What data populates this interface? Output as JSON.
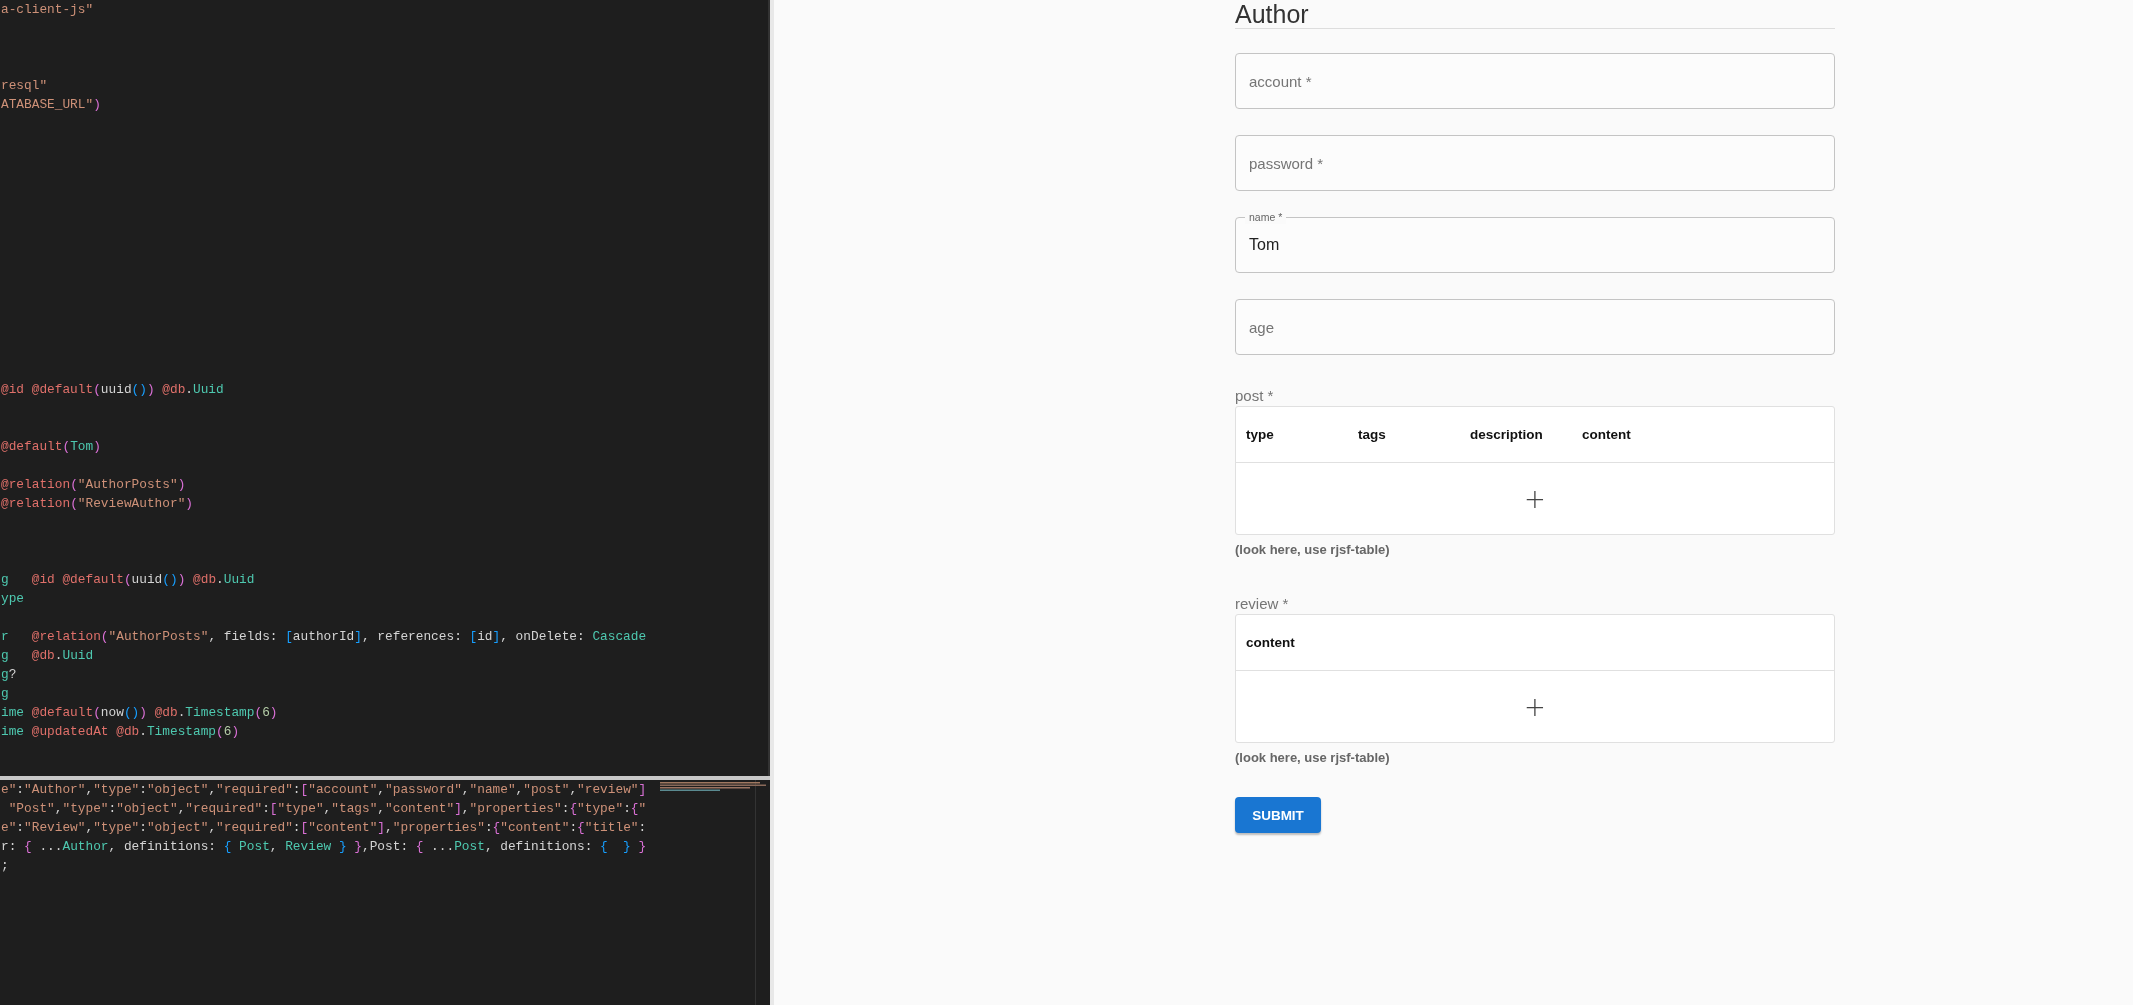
{
  "editor": {
    "code_lines": [
      {
        "kind": "code",
        "tokens": [
          {
            "kind": "str",
            "text": "a-client-js\""
          }
        ]
      },
      {
        "kind": "blank"
      },
      {
        "kind": "blank"
      },
      {
        "kind": "blank"
      },
      {
        "kind": "code",
        "tokens": [
          {
            "kind": "str",
            "text": "resql\""
          }
        ]
      },
      {
        "kind": "code",
        "tokens": [
          {
            "kind": "str",
            "text": "ATABASE_URL\""
          },
          {
            "kind": "p1",
            "text": ")"
          }
        ]
      },
      {
        "kind": "blank"
      },
      {
        "kind": "blank"
      },
      {
        "kind": "blank"
      },
      {
        "kind": "blank"
      },
      {
        "kind": "blank"
      },
      {
        "kind": "blank"
      },
      {
        "kind": "blank"
      },
      {
        "kind": "blank"
      },
      {
        "kind": "blank"
      },
      {
        "kind": "blank"
      },
      {
        "kind": "blank"
      },
      {
        "kind": "blank"
      },
      {
        "kind": "blank"
      },
      {
        "kind": "blank"
      },
      {
        "kind": "code",
        "tokens": [
          {
            "kind": "dec",
            "text": "@id @default"
          },
          {
            "kind": "p1",
            "text": "("
          },
          {
            "kind": "plain",
            "text": "uuid"
          },
          {
            "kind": "p2",
            "text": "()"
          },
          {
            "kind": "p1",
            "text": ")"
          },
          {
            "kind": "dec",
            "text": " @db"
          },
          {
            "kind": "plain",
            "text": "."
          },
          {
            "kind": "type",
            "text": "Uuid"
          }
        ]
      },
      {
        "kind": "blank"
      },
      {
        "kind": "blank"
      },
      {
        "kind": "code",
        "tokens": [
          {
            "kind": "dec",
            "text": "@default"
          },
          {
            "kind": "p1",
            "text": "("
          },
          {
            "kind": "type",
            "text": "Tom"
          },
          {
            "kind": "p1",
            "text": ")"
          }
        ]
      },
      {
        "kind": "blank"
      },
      {
        "kind": "code",
        "tokens": [
          {
            "kind": "dec",
            "text": "@relation"
          },
          {
            "kind": "p1",
            "text": "("
          },
          {
            "kind": "str",
            "text": "\"AuthorPosts\""
          },
          {
            "kind": "p1",
            "text": ")"
          }
        ]
      },
      {
        "kind": "code",
        "tokens": [
          {
            "kind": "dec",
            "text": "@relation"
          },
          {
            "kind": "p1",
            "text": "("
          },
          {
            "kind": "str",
            "text": "\"ReviewAuthor\""
          },
          {
            "kind": "p1",
            "text": ")"
          }
        ]
      },
      {
        "kind": "blank"
      },
      {
        "kind": "blank"
      },
      {
        "kind": "blank"
      },
      {
        "kind": "code",
        "tokens": [
          {
            "kind": "type",
            "text": "g"
          },
          {
            "kind": "dec",
            "text": "   @id @default"
          },
          {
            "kind": "p1",
            "text": "("
          },
          {
            "kind": "plain",
            "text": "uuid"
          },
          {
            "kind": "p2",
            "text": "()"
          },
          {
            "kind": "p1",
            "text": ")"
          },
          {
            "kind": "dec",
            "text": " @db"
          },
          {
            "kind": "plain",
            "text": "."
          },
          {
            "kind": "type",
            "text": "Uuid"
          }
        ]
      },
      {
        "kind": "code",
        "tokens": [
          {
            "kind": "type",
            "text": "ype"
          }
        ]
      },
      {
        "kind": "blank"
      },
      {
        "kind": "code",
        "tokens": [
          {
            "kind": "type",
            "text": "r"
          },
          {
            "kind": "dec",
            "text": "   @relation"
          },
          {
            "kind": "p1",
            "text": "("
          },
          {
            "kind": "str",
            "text": "\"AuthorPosts\""
          },
          {
            "kind": "plain",
            "text": ", fields: "
          },
          {
            "kind": "p2",
            "text": "["
          },
          {
            "kind": "plain",
            "text": "authorId"
          },
          {
            "kind": "p2",
            "text": "]"
          },
          {
            "kind": "plain",
            "text": ", references: "
          },
          {
            "kind": "p2",
            "text": "["
          },
          {
            "kind": "plain",
            "text": "id"
          },
          {
            "kind": "p2",
            "text": "]"
          },
          {
            "kind": "plain",
            "text": ", onDelete: "
          },
          {
            "kind": "type",
            "text": "Cascade"
          }
        ]
      },
      {
        "kind": "code",
        "tokens": [
          {
            "kind": "type",
            "text": "g"
          },
          {
            "kind": "dec",
            "text": "   @db"
          },
          {
            "kind": "plain",
            "text": "."
          },
          {
            "kind": "type",
            "text": "Uuid"
          }
        ]
      },
      {
        "kind": "code",
        "tokens": [
          {
            "kind": "type",
            "text": "g"
          },
          {
            "kind": "plain",
            "text": "?"
          }
        ]
      },
      {
        "kind": "code",
        "tokens": [
          {
            "kind": "type",
            "text": "g"
          }
        ]
      },
      {
        "kind": "code",
        "tokens": [
          {
            "kind": "type",
            "text": "ime"
          },
          {
            "kind": "dec",
            "text": " @default"
          },
          {
            "kind": "p1",
            "text": "("
          },
          {
            "kind": "plain",
            "text": "now"
          },
          {
            "kind": "p2",
            "text": "()"
          },
          {
            "kind": "p1",
            "text": ")"
          },
          {
            "kind": "dec",
            "text": " @db"
          },
          {
            "kind": "plain",
            "text": "."
          },
          {
            "kind": "type",
            "text": "Timestamp"
          },
          {
            "kind": "p1",
            "text": "("
          },
          {
            "kind": "num",
            "text": "6"
          },
          {
            "kind": "p1",
            "text": ")"
          }
        ]
      },
      {
        "kind": "code",
        "tokens": [
          {
            "kind": "type",
            "text": "ime"
          },
          {
            "kind": "dec",
            "text": " @updatedAt @db"
          },
          {
            "kind": "plain",
            "text": "."
          },
          {
            "kind": "type",
            "text": "Timestamp"
          },
          {
            "kind": "p1",
            "text": "("
          },
          {
            "kind": "num",
            "text": "6"
          },
          {
            "kind": "p1",
            "text": ")"
          }
        ]
      }
    ],
    "output_lines": [
      {
        "kind": "code",
        "tokens": [
          {
            "kind": "str",
            "text": "e\""
          },
          {
            "kind": "plain",
            "text": ":"
          },
          {
            "kind": "str",
            "text": "\"Author\""
          },
          {
            "kind": "plain",
            "text": ","
          },
          {
            "kind": "str",
            "text": "\"type\""
          },
          {
            "kind": "plain",
            "text": ":"
          },
          {
            "kind": "str",
            "text": "\"object\""
          },
          {
            "kind": "plain",
            "text": ","
          },
          {
            "kind": "str",
            "text": "\"required\""
          },
          {
            "kind": "plain",
            "text": ":"
          },
          {
            "kind": "p1",
            "text": "["
          },
          {
            "kind": "str",
            "text": "\"account\""
          },
          {
            "kind": "plain",
            "text": ","
          },
          {
            "kind": "str",
            "text": "\"password\""
          },
          {
            "kind": "plain",
            "text": ","
          },
          {
            "kind": "str",
            "text": "\"name\""
          },
          {
            "kind": "plain",
            "text": ","
          },
          {
            "kind": "str",
            "text": "\"post\""
          },
          {
            "kind": "plain",
            "text": ","
          },
          {
            "kind": "str",
            "text": "\"review\""
          },
          {
            "kind": "p1",
            "text": "]"
          }
        ]
      },
      {
        "kind": "code",
        "tokens": [
          {
            "kind": "str",
            "text": " \"Post\""
          },
          {
            "kind": "plain",
            "text": ","
          },
          {
            "kind": "str",
            "text": "\"type\""
          },
          {
            "kind": "plain",
            "text": ":"
          },
          {
            "kind": "str",
            "text": "\"object\""
          },
          {
            "kind": "plain",
            "text": ","
          },
          {
            "kind": "str",
            "text": "\"required\""
          },
          {
            "kind": "plain",
            "text": ":"
          },
          {
            "kind": "p1",
            "text": "["
          },
          {
            "kind": "str",
            "text": "\"type\""
          },
          {
            "kind": "plain",
            "text": ","
          },
          {
            "kind": "str",
            "text": "\"tags\""
          },
          {
            "kind": "plain",
            "text": ","
          },
          {
            "kind": "str",
            "text": "\"content\""
          },
          {
            "kind": "p1",
            "text": "]"
          },
          {
            "kind": "plain",
            "text": ","
          },
          {
            "kind": "str",
            "text": "\"properties\""
          },
          {
            "kind": "plain",
            "text": ":"
          },
          {
            "kind": "p1",
            "text": "{"
          },
          {
            "kind": "str",
            "text": "\"type\""
          },
          {
            "kind": "plain",
            "text": ":"
          },
          {
            "kind": "p1",
            "text": "{"
          },
          {
            "kind": "str",
            "text": "\""
          }
        ]
      },
      {
        "kind": "code",
        "tokens": [
          {
            "kind": "str",
            "text": "e\""
          },
          {
            "kind": "plain",
            "text": ":"
          },
          {
            "kind": "str",
            "text": "\"Review\""
          },
          {
            "kind": "plain",
            "text": ","
          },
          {
            "kind": "str",
            "text": "\"type\""
          },
          {
            "kind": "plain",
            "text": ":"
          },
          {
            "kind": "str",
            "text": "\"object\""
          },
          {
            "kind": "plain",
            "text": ","
          },
          {
            "kind": "str",
            "text": "\"required\""
          },
          {
            "kind": "plain",
            "text": ":"
          },
          {
            "kind": "p1",
            "text": "["
          },
          {
            "kind": "str",
            "text": "\"content\""
          },
          {
            "kind": "p1",
            "text": "]"
          },
          {
            "kind": "plain",
            "text": ","
          },
          {
            "kind": "str",
            "text": "\"properties\""
          },
          {
            "kind": "plain",
            "text": ":"
          },
          {
            "kind": "p1",
            "text": "{"
          },
          {
            "kind": "str",
            "text": "\"content\""
          },
          {
            "kind": "plain",
            "text": ":"
          },
          {
            "kind": "p1",
            "text": "{"
          },
          {
            "kind": "str",
            "text": "\"title\""
          },
          {
            "kind": "plain",
            "text": ":"
          }
        ]
      },
      {
        "kind": "code",
        "tokens": [
          {
            "kind": "plain",
            "text": "r: "
          },
          {
            "kind": "p1",
            "text": "{"
          },
          {
            "kind": "plain",
            "text": " ..."
          },
          {
            "kind": "type",
            "text": "Author"
          },
          {
            "kind": "plain",
            "text": ", definitions: "
          },
          {
            "kind": "p2",
            "text": "{"
          },
          {
            "kind": "type",
            "text": " Post"
          },
          {
            "kind": "plain",
            "text": ", "
          },
          {
            "kind": "type",
            "text": "Review"
          },
          {
            "kind": "p2",
            "text": " }"
          },
          {
            "kind": "p1",
            "text": " }"
          },
          {
            "kind": "plain",
            "text": ",Post: "
          },
          {
            "kind": "p1",
            "text": "{"
          },
          {
            "kind": "plain",
            "text": " ..."
          },
          {
            "kind": "type",
            "text": "Post"
          },
          {
            "kind": "plain",
            "text": ", definitions: "
          },
          {
            "kind": "p2",
            "text": "{  }"
          },
          {
            "kind": "p1",
            "text": " }"
          }
        ]
      },
      {
        "kind": "code",
        "tokens": [
          {
            "kind": "plain",
            "text": ";"
          }
        ]
      }
    ]
  },
  "form": {
    "title": "Author",
    "fields": [
      {
        "label": "account *"
      },
      {
        "label": "password *"
      },
      {
        "label": "name *",
        "value": "Tom"
      },
      {
        "label": "age"
      }
    ],
    "tables": [
      {
        "label": "post *",
        "columns": [
          "type",
          "tags",
          "description",
          "content"
        ],
        "add_icon": "+",
        "hint": "(look here, use rjsf-table)"
      },
      {
        "label": "review *",
        "columns": [
          "content"
        ],
        "add_icon": "+",
        "hint": "(look here, use rjsf-table)"
      }
    ],
    "submit": "SUBMIT"
  }
}
